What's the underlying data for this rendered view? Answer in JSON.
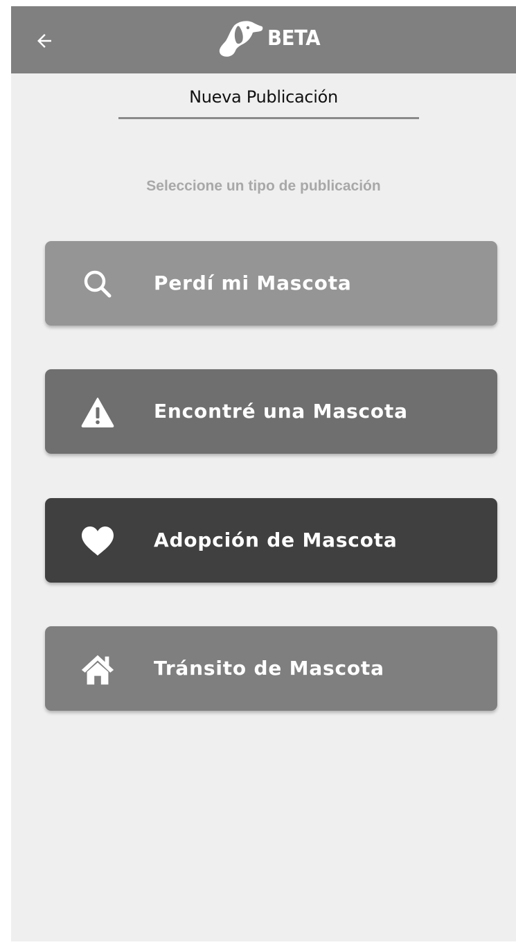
{
  "app_bar": {
    "background_color": "#808080",
    "back_icon": "arrow-left-icon",
    "logo_icon": "dog-head-logo-icon",
    "logo_text": "BETA"
  },
  "page": {
    "title": "Nueva Publicación",
    "subtitle": "Seleccione un tipo de publicación",
    "background_color": "#efefef"
  },
  "options": [
    {
      "label": "Perdí mi Mascota",
      "icon": "search-icon",
      "color": "#959595"
    },
    {
      "label": "Encontré una Mascota",
      "icon": "warning-icon",
      "color": "#6f6f6f"
    },
    {
      "label": "Adopción de Mascota",
      "icon": "heart-icon",
      "color": "#404040"
    },
    {
      "label": "Tránsito de Mascota",
      "icon": "home-icon",
      "color": "#7f7f7f"
    }
  ]
}
